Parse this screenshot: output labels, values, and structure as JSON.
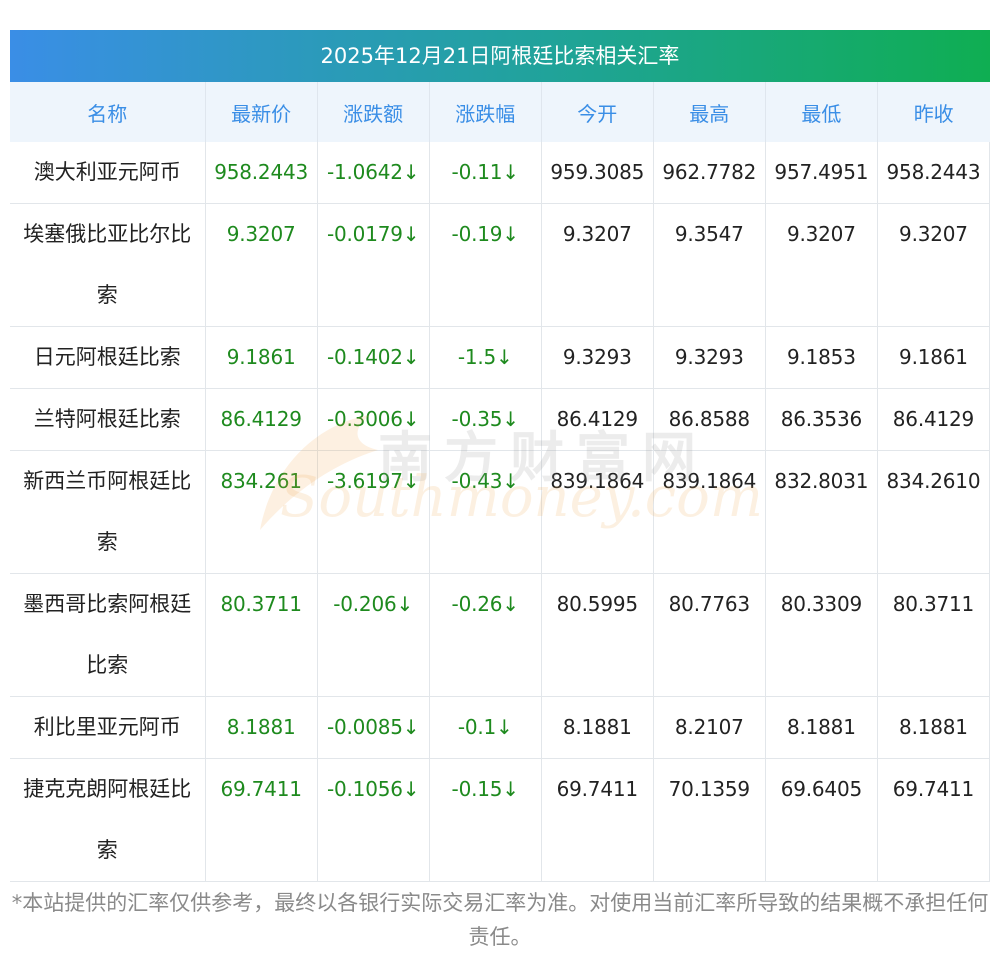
{
  "title": "2025年12月21日阿根廷比索相关汇率",
  "columns": [
    "名称",
    "最新价",
    "涨跌额",
    "涨跌幅",
    "今开",
    "最高",
    "最低",
    "昨收"
  ],
  "rows": [
    {
      "name": "澳大利亚元阿币",
      "latest": "958.2443",
      "change": "-1.0642↓",
      "pct": "-0.11↓",
      "open": "959.3085",
      "high": "962.7782",
      "low": "957.4951",
      "prev": "958.2443"
    },
    {
      "name": "埃塞俄比亚比尔比索",
      "latest": "9.3207",
      "change": "-0.0179↓",
      "pct": "-0.19↓",
      "open": "9.3207",
      "high": "9.3547",
      "low": "9.3207",
      "prev": "9.3207"
    },
    {
      "name": "日元阿根廷比索",
      "latest": "9.1861",
      "change": "-0.1402↓",
      "pct": "-1.5↓",
      "open": "9.3293",
      "high": "9.3293",
      "low": "9.1853",
      "prev": "9.1861"
    },
    {
      "name": "兰特阿根廷比索",
      "latest": "86.4129",
      "change": "-0.3006↓",
      "pct": "-0.35↓",
      "open": "86.4129",
      "high": "86.8588",
      "low": "86.3536",
      "prev": "86.4129"
    },
    {
      "name": "新西兰币阿根廷比索",
      "latest": "834.261",
      "change": "-3.6197↓",
      "pct": "-0.43↓",
      "open": "839.1864",
      "high": "839.1864",
      "low": "832.8031",
      "prev": "834.2610"
    },
    {
      "name": "墨西哥比索阿根廷比索",
      "latest": "80.3711",
      "change": "-0.206↓",
      "pct": "-0.26↓",
      "open": "80.5995",
      "high": "80.7763",
      "low": "80.3309",
      "prev": "80.3711"
    },
    {
      "name": "利比里亚元阿币",
      "latest": "8.1881",
      "change": "-0.0085↓",
      "pct": "-0.1↓",
      "open": "8.1881",
      "high": "8.2107",
      "low": "8.1881",
      "prev": "8.1881"
    },
    {
      "name": "捷克克朗阿根廷比索",
      "latest": "69.7411",
      "change": "-0.1056↓",
      "pct": "-0.15↓",
      "open": "69.7411",
      "high": "70.1359",
      "low": "69.6405",
      "prev": "69.7411"
    }
  ],
  "watermark": {
    "cn": "南方财富网",
    "en": "Southmoney.com"
  },
  "footnote": "*本站提供的汇率仅供参考，最终以各银行实际交易汇率为准。对使用当前汇率所导致的结果概不承担任何责任。",
  "colors": {
    "header_text": "#3a8ee6",
    "up_down_green": "#1e8a1e",
    "title_grad_start": "#3a8ee6",
    "title_grad_end": "#0fae52"
  }
}
